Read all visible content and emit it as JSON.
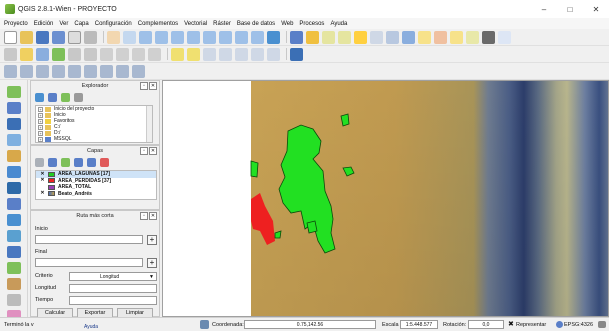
{
  "window": {
    "title": "QGIS 2.8.1-Wien - PROYECTO",
    "minimize": "–",
    "maximize": "□",
    "close": "✕"
  },
  "menu": [
    "Proyecto",
    "Edición",
    "Ver",
    "Capa",
    "Configuración",
    "Complementos",
    "Vectorial",
    "Ráster",
    "Base de datos",
    "Web",
    "Procesos",
    "Ayuda"
  ],
  "browser_panel": {
    "title": "Explorador",
    "items": [
      {
        "label": "Inicio del proyecto",
        "expander": "+"
      },
      {
        "label": "Inicio",
        "expander": "+"
      },
      {
        "label": "Favoritos",
        "expander": "+"
      },
      {
        "label": "C:/",
        "expander": "+"
      },
      {
        "label": "D:/",
        "expander": "+"
      },
      {
        "label": "MSSQL",
        "expander": "+"
      }
    ]
  },
  "layers_panel": {
    "title": "Capas",
    "layers": [
      {
        "label": "AREA_LAGUNAS [17]",
        "checked": "✕",
        "color": "#22cc22",
        "selected": "true"
      },
      {
        "label": "AREA_PERDIDAS [37]",
        "checked": "✕",
        "color": "#ee2222",
        "selected": "false"
      },
      {
        "label": "AREA_TOTAL",
        "checked": "",
        "color": "#9a3fb5",
        "selected": "false"
      },
      {
        "label": "Beato_Andrés",
        "checked": "✕",
        "color": "#4a6fb5",
        "selected": "false"
      }
    ]
  },
  "route_panel": {
    "title": "Ruta más corta",
    "inicio_label": "Inicio",
    "final_label": "Final",
    "criterio_label": "Criterio",
    "criterio_value": "Longitud",
    "longitud_label": "Longitud",
    "tiempo_label": "Tiempo",
    "plus": "+",
    "calcular": "Calcular",
    "exportar": "Exportar",
    "limpiar": "Limpiar"
  },
  "status": {
    "left_text": "Terminó la v",
    "help_label": "Ayuda",
    "coord_label": "Coordenada:",
    "coord_value": "0.75,142.56",
    "scale_label": "Escala",
    "scale_value": "1:5.448.577",
    "rotation_label": "Rotación:",
    "rotation_value": "0,0",
    "render_label": "Representar",
    "crs_label": "EPSG:4326"
  },
  "colors": {
    "lagunas": "#22e022",
    "perdidas": "#ee2020",
    "accent": "#cfe3f7"
  }
}
